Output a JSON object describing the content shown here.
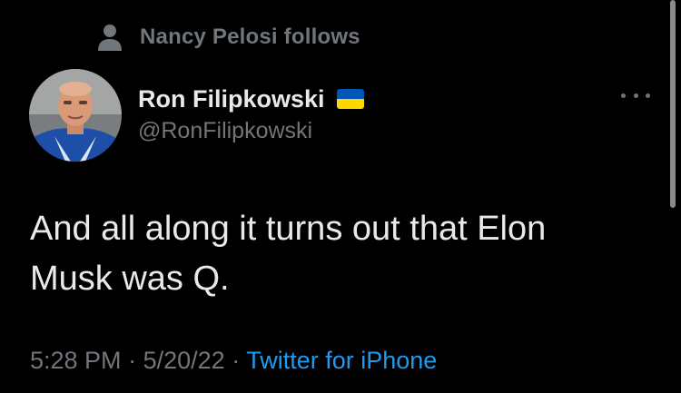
{
  "social_context": {
    "icon": "person-icon",
    "text": "Nancy Pelosi follows"
  },
  "author": {
    "display_name": "Ron Filipkowski",
    "flag_icon": "ukraine-flag-icon",
    "flag_colors": [
      "#0057b7",
      "#ffd700"
    ],
    "handle": "@RonFilipkowski"
  },
  "more_icon": "ellipsis-icon",
  "tweet": {
    "text": "And all along it turns out that Elon Musk was Q.",
    "time": "5:28 PM",
    "separator": "·",
    "date": "5/20/22",
    "source": "Twitter for iPhone"
  },
  "colors": {
    "background": "#000000",
    "primary_text": "#e7e9ea",
    "secondary_text": "#71767b",
    "link": "#1d9bf0"
  }
}
